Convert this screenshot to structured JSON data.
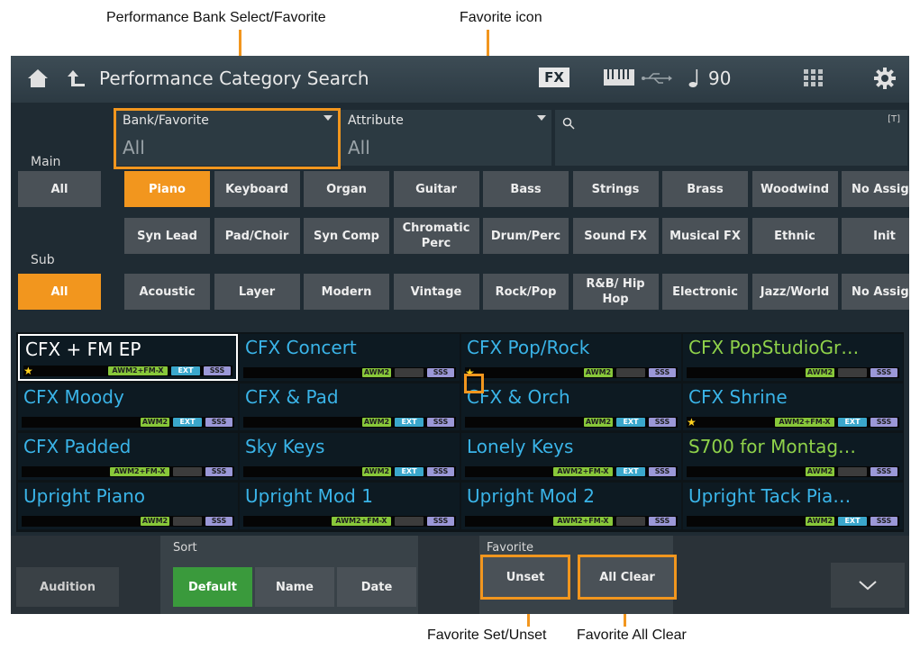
{
  "annotations": {
    "bank_select": "Performance Bank Select/Favorite",
    "favorite_icon": "Favorite icon",
    "favorite_set": "Favorite Set/Unset",
    "favorite_all_clear": "Favorite All Clear"
  },
  "topbar": {
    "title": "Performance Category Search",
    "fx": "FX",
    "tempo": "90"
  },
  "filters": {
    "bank_label": "Bank/Favorite",
    "bank_value": "All",
    "attribute_label": "Attribute",
    "attribute_value": "All",
    "search_tag": "[T]"
  },
  "main": {
    "label": "Main",
    "all": "All",
    "categories": [
      "Piano",
      "Keyboard",
      "Organ",
      "Guitar",
      "Bass",
      "Strings",
      "Brass",
      "Woodwind",
      "No Assign"
    ],
    "selected": "Piano",
    "row2": [
      "Syn Lead",
      "Pad/Choir",
      "Syn Comp",
      "Chromatic Perc",
      "Drum/Perc",
      "Sound FX",
      "Musical FX",
      "Ethnic",
      "Init"
    ]
  },
  "sub": {
    "label": "Sub",
    "all": "All",
    "categories": [
      "Acoustic",
      "Layer",
      "Modern",
      "Vintage",
      "Rock/Pop",
      "R&B/ Hip Hop",
      "Electronic",
      "Jazz/World",
      "No Assign"
    ]
  },
  "performances": [
    {
      "name": "CFX + FM EP",
      "color": "#ffffff",
      "star": true,
      "tags": [
        "AWM2+FM-X",
        "EXT",
        "SSS"
      ],
      "selected": true
    },
    {
      "name": "CFX Concert",
      "color": "#3ab4e8",
      "star": false,
      "tags": [
        "AWM2",
        "",
        "SSS"
      ]
    },
    {
      "name": "CFX Pop/Rock",
      "color": "#3ab4e8",
      "star": true,
      "tags": [
        "AWM2",
        "",
        "SSS"
      ]
    },
    {
      "name": "CFX PopStudioGr…",
      "color": "#8fd24a",
      "star": false,
      "tags": [
        "AWM2",
        "",
        "SSS"
      ]
    },
    {
      "name": "CFX Moody",
      "color": "#3ab4e8",
      "star": false,
      "tags": [
        "AWM2",
        "EXT",
        "SSS"
      ]
    },
    {
      "name": "CFX & Pad",
      "color": "#3ab4e8",
      "star": false,
      "tags": [
        "AWM2",
        "EXT",
        "SSS"
      ]
    },
    {
      "name": "CFX & Orch",
      "color": "#3ab4e8",
      "star": false,
      "tags": [
        "AWM2",
        "EXT",
        "SSS"
      ]
    },
    {
      "name": "CFX Shrine",
      "color": "#3ab4e8",
      "star": true,
      "tags": [
        "AWM2+FM-X",
        "EXT",
        "SSS"
      ]
    },
    {
      "name": "CFX Padded",
      "color": "#3ab4e8",
      "star": false,
      "tags": [
        "AWM2+FM-X",
        "",
        "SSS"
      ]
    },
    {
      "name": "Sky Keys",
      "color": "#3ab4e8",
      "star": false,
      "tags": [
        "AWM2",
        "EXT",
        "SSS"
      ]
    },
    {
      "name": "Lonely Keys",
      "color": "#3ab4e8",
      "star": false,
      "tags": [
        "AWM2+FM-X",
        "EXT",
        "SSS"
      ]
    },
    {
      "name": "S700 for Montag…",
      "color": "#8fd24a",
      "star": false,
      "tags": [
        "AWM2",
        "",
        "SSS"
      ]
    },
    {
      "name": "Upright Piano",
      "color": "#3ab4e8",
      "star": false,
      "tags": [
        "AWM2",
        "",
        "SSS"
      ]
    },
    {
      "name": "Upright Mod 1",
      "color": "#3ab4e8",
      "star": false,
      "tags": [
        "AWM2+FM-X",
        "",
        "SSS"
      ]
    },
    {
      "name": "Upright Mod 2",
      "color": "#3ab4e8",
      "star": false,
      "tags": [
        "AWM2+FM-X",
        "",
        "SSS"
      ]
    },
    {
      "name": "Upright Tack Pia…",
      "color": "#3ab4e8",
      "star": false,
      "tags": [
        "AWM2",
        "EXT",
        "SSS"
      ]
    }
  ],
  "bottom": {
    "audition": "Audition",
    "sort_label": "Sort",
    "sort_options": [
      "Default",
      "Name",
      "Date"
    ],
    "sort_selected": "Default",
    "favorite_label": "Favorite",
    "unset": "Unset",
    "all_clear": "All Clear"
  },
  "colors": {
    "accent": "#f2961e",
    "awm_tag": "#88c83a",
    "ssf_tag": "#9b98d8",
    "ext_tag": "#3aa7cc"
  }
}
